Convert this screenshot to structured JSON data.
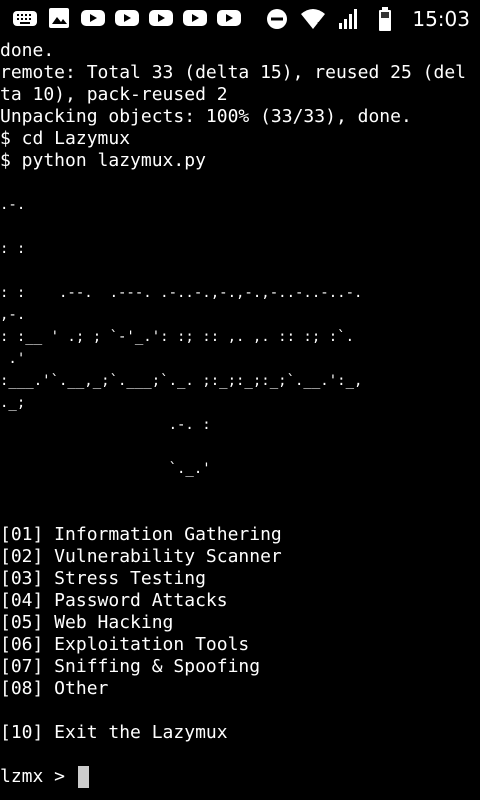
{
  "statusbar": {
    "time": "15:03",
    "left_icons": [
      "keyboard-icon",
      "image-icon",
      "youtube-icon",
      "youtube-icon",
      "youtube-icon",
      "youtube-icon",
      "youtube-icon"
    ],
    "right_icons": [
      "do-not-disturb-icon",
      "wifi-icon",
      "signal-icon",
      "battery-icon"
    ]
  },
  "terminal": {
    "lines": [
      "done.",
      "remote: Total 33 (delta 15), reused 25 (del",
      "ta 10), pack-reused 2",
      "Unpacking objects: 100% (33/33), done.",
      "$ cd Lazymux",
      "$ python lazymux.py",
      "",
      ".-.",
      "",
      ": :",
      "",
      ": :    .--.  .---. .-..-.,-.,-.,-..-..-..-.",
      ",-.",
      ": :__ ' .; ; `-'_.': :; :: ,. ,. :: :; :`.",
      " .'",
      ":___.'`.__,_;`.___;`._. ;:_;:_;:_;`.__.':_,",
      "._;",
      "                    .-. :",
      "",
      "                    `._.'",
      "",
      "",
      "[01] Information Gathering",
      "[02] Vulnerability Scanner",
      "[03] Stress Testing",
      "[04] Password Attacks",
      "[05] Web Hacking",
      "[06] Exploitation Tools",
      "[07] Sniffing & Spoofing",
      "[08] Other",
      "",
      "[10] Exit the Lazymux",
      ""
    ],
    "prompt": "lzmx > "
  }
}
